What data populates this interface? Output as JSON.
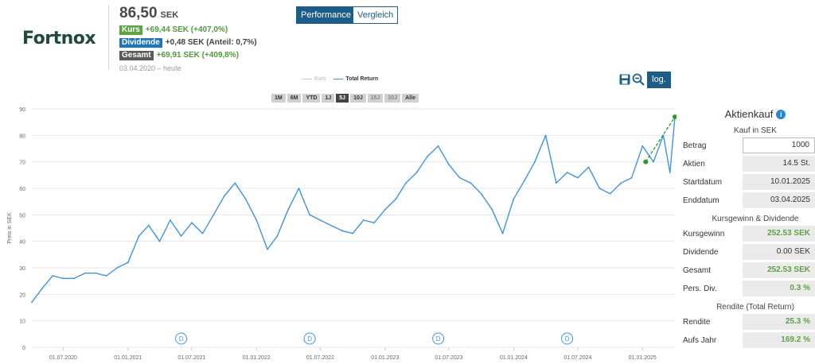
{
  "logo": "Fortnox",
  "price": {
    "value": "86,50",
    "unit": "SEK"
  },
  "performance": {
    "kurs": {
      "label": "Kurs",
      "text": "+69,44 SEK (+407,0%)"
    },
    "dividende": {
      "label": "Dividende",
      "text": "+0,48 SEK (Anteil: 0,7%)"
    },
    "gesamt": {
      "label": "Gesamt",
      "text": "+69,91 SEK (+409,8%)"
    },
    "dates": "03.04.2020 – heute"
  },
  "buttons": {
    "performance": "Performance",
    "vergleich": "Vergleich",
    "log": "log."
  },
  "icons": {
    "save": "save-icon",
    "zoom": "zoom-out-icon"
  },
  "range_buttons": [
    {
      "label": "1M",
      "state": "normal"
    },
    {
      "label": "6M",
      "state": "normal"
    },
    {
      "label": "YTD",
      "state": "normal"
    },
    {
      "label": "1J",
      "state": "normal"
    },
    {
      "label": "5J",
      "state": "active"
    },
    {
      "label": "10J",
      "state": "normal"
    },
    {
      "label": "15J",
      "state": "disabled"
    },
    {
      "label": "20J",
      "state": "disabled"
    },
    {
      "label": "Alle",
      "state": "normal"
    }
  ],
  "colors": {
    "total_return": "#3d95df",
    "kurs": "#c8c8c8",
    "trend": "#2a9a2a",
    "dividend_marker": "#3d95df"
  },
  "chart_data": {
    "type": "line",
    "title": "",
    "ylabel": "Preis in SEK",
    "ylim": [
      0,
      90
    ],
    "yticks": [
      0,
      10,
      20,
      30,
      40,
      50,
      60,
      70,
      80,
      90
    ],
    "xlim": [
      "2020-04-03",
      "2025-04-03"
    ],
    "xticks": [
      {
        "date": "2020-07-01",
        "label": "01.07.2020"
      },
      {
        "date": "2021-01-01",
        "label": "01.01.2021"
      },
      {
        "date": "2021-07-01",
        "label": "01.07.2021"
      },
      {
        "date": "2022-01-01",
        "label": "01.01.2022"
      },
      {
        "date": "2022-07-01",
        "label": "01.07.2022"
      },
      {
        "date": "2023-01-01",
        "label": "01.01.2023"
      },
      {
        "date": "2023-07-01",
        "label": "01.07.2023"
      },
      {
        "date": "2024-01-01",
        "label": "01.01.2024"
      },
      {
        "date": "2024-07-01",
        "label": "01.07.2024"
      },
      {
        "date": "2025-01-01",
        "label": "01.01.2025"
      }
    ],
    "legend": [
      "Kurs",
      "Total Return"
    ],
    "series": [
      {
        "name": "Total Return",
        "x": [
          "2020-04-03",
          "2020-05-01",
          "2020-06-01",
          "2020-07-01",
          "2020-08-01",
          "2020-09-01",
          "2020-10-01",
          "2020-11-01",
          "2020-12-01",
          "2021-01-01",
          "2021-02-01",
          "2021-03-01",
          "2021-04-01",
          "2021-05-01",
          "2021-06-01",
          "2021-07-01",
          "2021-08-01",
          "2021-09-01",
          "2021-10-01",
          "2021-11-01",
          "2021-12-01",
          "2022-01-01",
          "2022-02-01",
          "2022-03-01",
          "2022-04-01",
          "2022-05-01",
          "2022-06-01",
          "2022-07-01",
          "2022-08-01",
          "2022-09-01",
          "2022-10-01",
          "2022-11-01",
          "2022-12-01",
          "2023-01-01",
          "2023-02-01",
          "2023-03-01",
          "2023-04-01",
          "2023-05-01",
          "2023-06-01",
          "2023-07-01",
          "2023-08-01",
          "2023-09-01",
          "2023-10-01",
          "2023-11-01",
          "2023-12-01",
          "2024-01-01",
          "2024-02-01",
          "2024-03-01",
          "2024-04-01",
          "2024-05-01",
          "2024-06-01",
          "2024-07-01",
          "2024-08-01",
          "2024-09-01",
          "2024-10-01",
          "2024-11-01",
          "2024-12-01",
          "2025-01-01",
          "2025-02-01",
          "2025-03-01",
          "2025-03-20",
          "2025-04-03"
        ],
        "values": [
          17,
          22,
          27,
          26,
          26,
          28,
          28,
          27,
          30,
          32,
          42,
          46,
          40,
          48,
          42,
          47,
          43,
          50,
          57,
          62,
          56,
          48,
          37,
          42,
          52,
          60,
          50,
          48,
          46,
          44,
          43,
          48,
          47,
          52,
          56,
          62,
          66,
          72,
          76,
          69,
          64,
          62,
          58,
          52,
          43,
          56,
          63,
          70,
          80,
          62,
          66,
          64,
          68,
          60,
          58,
          62,
          64,
          76,
          70,
          80,
          66,
          87
        ]
      }
    ],
    "trend": {
      "x": [
        "2025-01-10",
        "2025-04-03"
      ],
      "values": [
        70,
        87
      ]
    },
    "dividends": [
      {
        "x": "2021-06-01",
        "label": "D"
      },
      {
        "x": "2022-06-01",
        "label": "D"
      },
      {
        "x": "2023-06-01",
        "label": "D"
      },
      {
        "x": "2024-06-01",
        "label": "D"
      }
    ]
  },
  "panel": {
    "title": "Aktienkauf",
    "subtitle": "Kauf in SEK",
    "rows": [
      {
        "label": "Betrag",
        "value": "1000",
        "kind": "input"
      },
      {
        "label": "Aktien",
        "value": "14.5 St.",
        "kind": "plain"
      },
      {
        "label": "Startdatum",
        "value": "10.01.2025",
        "kind": "plain"
      },
      {
        "label": "Enddatum",
        "value": "03.04.2025",
        "kind": "plain"
      }
    ],
    "section2": "Kursgewinn & Dividende",
    "rows2": [
      {
        "label": "Kursgewinn",
        "value": "252.53 SEK",
        "kind": "green"
      },
      {
        "label": "Dividende",
        "value": "0.00 SEK",
        "kind": "plain"
      },
      {
        "label": "Gesamt",
        "value": "252.53 SEK",
        "kind": "green"
      },
      {
        "label": "Pers. Div.",
        "value": "0.3 %",
        "kind": "green"
      }
    ],
    "section3": "Rendite (Total Return)",
    "rows3": [
      {
        "label": "Rendite",
        "value": "25.3 %",
        "kind": "green"
      },
      {
        "label": "Aufs Jahr",
        "value": "169.2 %",
        "kind": "green"
      }
    ]
  }
}
